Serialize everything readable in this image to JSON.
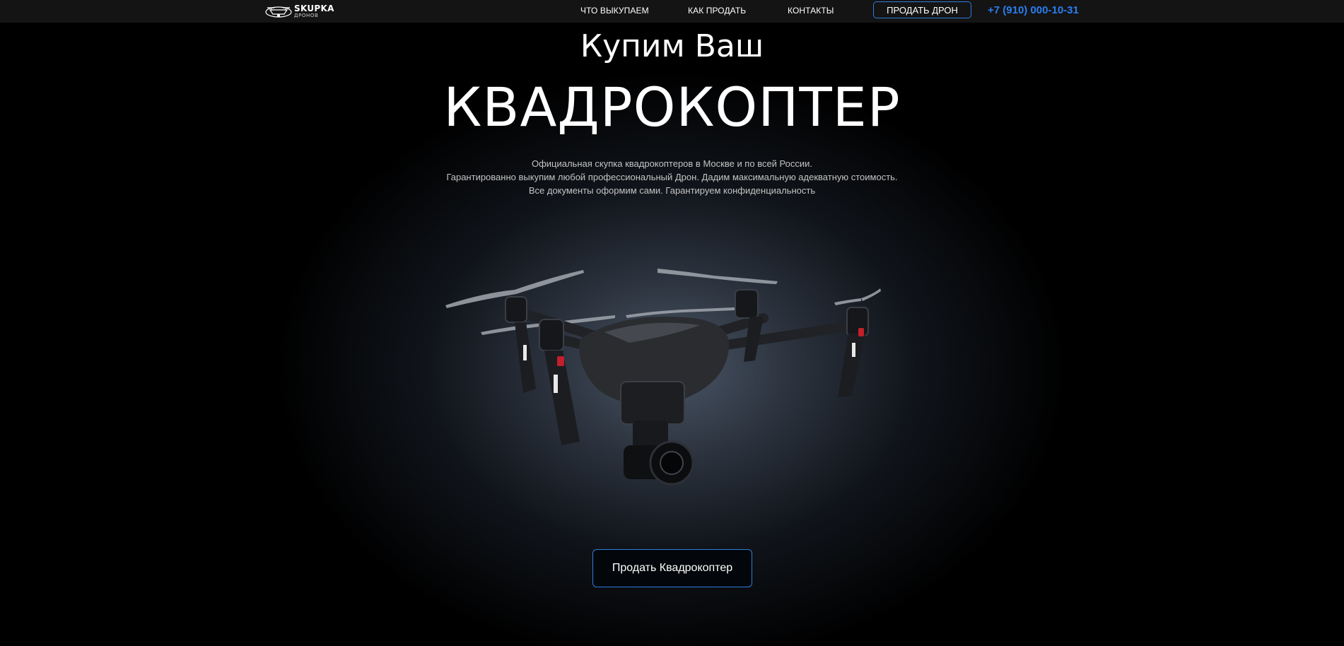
{
  "header": {
    "logo_main": "SKUPKA",
    "logo_sub": "ДРОНОВ",
    "nav": [
      {
        "label": "ЧТО ВЫКУПАЕМ"
      },
      {
        "label": "КАК ПРОДАТЬ"
      },
      {
        "label": "КОНТАКТЫ"
      }
    ],
    "sell_button": "ПРОДАТЬ ДРОН",
    "phone": "+7 (910) 000-10-31"
  },
  "hero": {
    "kicker": "Купим Ваш",
    "title": "КВАДРОКОПТЕР",
    "description": [
      "Официальная скупка квадрокоптеров в Москве и по всей России.",
      "Гарантированно выкупим любой профессиональный Дрон. Дадим максимальную адекватную стоимость.",
      "Все документы оформим сами. Гарантируем конфиденциальность"
    ],
    "cta": "Продать Квадрокоптер"
  },
  "colors": {
    "accent": "#2f7ddc",
    "phone": "#2a7ef0",
    "background": "#000000",
    "topbar": "#141414"
  },
  "icons": {
    "logo": "drone-logo-icon",
    "hero_image": "quadcopter-image"
  }
}
